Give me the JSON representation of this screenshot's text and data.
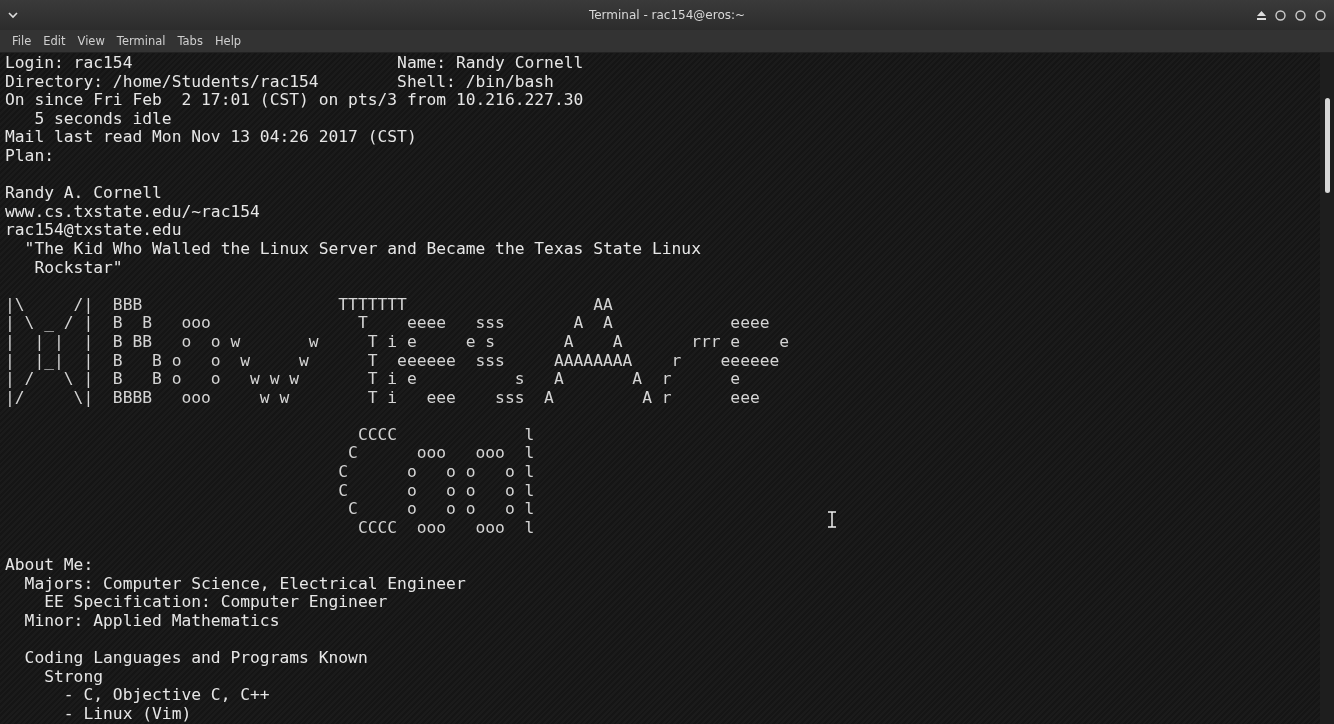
{
  "window": {
    "title": "Terminal - rac154@eros:~"
  },
  "menu": [
    "File",
    "Edit",
    "View",
    "Terminal",
    "Tabs",
    "Help"
  ],
  "finger": {
    "blocks": [
      {
        "kind": "text",
        "lines": [
          "Login: rac154                           Name: Randy Cornell",
          "Directory: /home/Students/rac154        Shell: /bin/bash",
          "On since Fri Feb  2 17:01 (CST) on pts/3 from 10.216.227.30",
          "   5 seconds idle",
          "Mail last read Mon Nov 13 04:26 2017 (CST)",
          "Plan:"
        ]
      },
      {
        "kind": "text",
        "lines": [
          "Randy A. Cornell",
          "www.cs.txstate.edu/~rac154",
          "rac154@txstate.edu",
          "  \"The Kid Who Walled the Linux Server and Became the Texas State Linux",
          "   Rockstar\""
        ]
      },
      {
        "kind": "art",
        "lines": [
          "|\\     /|  BBB                    TTTTTTT                   AA",
          "| \\ _ / |  B  B   ooo               T    eeee   sss       A  A            eeee",
          "|  | |  |  B BB   o  o w       w     T i e     e s       A    A       rrr e    e",
          "|  |_|  |  B   B o   o  w     w      T  eeeeee  sss     AAAAAAAA    r    eeeeee",
          "| /   \\ |  B   B o   o   w w w       T i e          s   A       A  r      e",
          "|/     \\|  BBBB   ooo     w w        T i   eee    sss  A         A r      eee"
        ]
      },
      {
        "kind": "art",
        "lines": [
          "                                    CCCC             l",
          "                                   C      ooo   ooo  l",
          "                                  C      o   o o   o l",
          "                                  C      o   o o   o l",
          "                                   C     o   o o   o l",
          "                                    CCCC  ooo   ooo  l"
        ]
      }
    ],
    "about_blocks": [
      {
        "kind": "text",
        "lines": [
          "About Me:",
          "  Majors: Computer Science, Electrical Engineer",
          "    EE Specification: Computer Engineer",
          "  Minor: Applied Mathematics"
        ]
      },
      {
        "kind": "text",
        "lines": [
          "  Coding Languages and Programs Known",
          "    Strong",
          "      - C, Objective C, C++",
          "      - Linux (Vim)"
        ]
      }
    ]
  }
}
